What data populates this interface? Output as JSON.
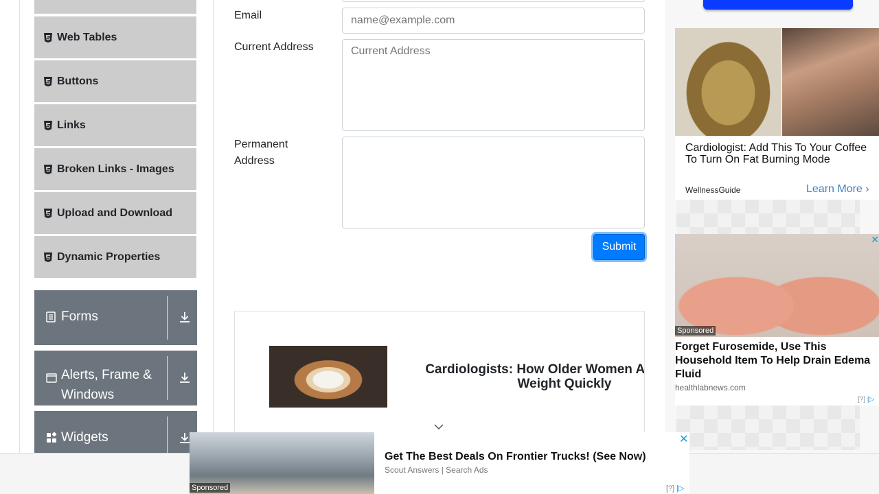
{
  "sidebar": {
    "items": [
      {
        "label": "Web Tables",
        "icon": "html5-icon"
      },
      {
        "label": "Buttons",
        "icon": "html5-icon"
      },
      {
        "label": "Links",
        "icon": "html5-icon"
      },
      {
        "label": "Broken Links - Images",
        "icon": "html5-icon"
      },
      {
        "label": "Upload and Download",
        "icon": "html5-icon"
      },
      {
        "label": "Dynamic Properties",
        "icon": "html5-icon"
      }
    ],
    "groups": [
      {
        "label": "Forms",
        "icon": "document-icon"
      },
      {
        "label": "Alerts, Frame & Windows",
        "icon": "window-icon"
      },
      {
        "label": "Widgets",
        "icon": "widgets-icon"
      }
    ]
  },
  "form": {
    "email_label": "Email",
    "email_placeholder": "name@example.com",
    "current_address_label": "Current Address",
    "current_address_placeholder": "Current Address",
    "permanent_address_label": "Permanent Address",
    "submit_label": "Submit"
  },
  "inline_ad": {
    "title": "Cardiologists: How Older Women Are Losing Weight Quickly"
  },
  "right_ads": {
    "ad1": {
      "title": "Cardiologist: Add This To Your Coffee To Turn On Fat Burning Mode",
      "source": "WellnessGuide",
      "cta": "Learn More"
    },
    "ad2": {
      "sponsored": "Sponsored",
      "title": "Forget Furosemide, Use This Household Item To Help Drain Edema Fluid",
      "source": "healthlabnews.com",
      "info": "[?]"
    }
  },
  "bottom_ad": {
    "sponsored": "Sponsored",
    "title": "Get The Best Deals On Frontier Trucks! (See Now)",
    "source": "Scout Answers | Search Ads",
    "info": "[?]"
  },
  "colors": {
    "primary": "#007bff",
    "sidebar_item_bg": "#cccccc",
    "group_bg": "#6c757d"
  }
}
